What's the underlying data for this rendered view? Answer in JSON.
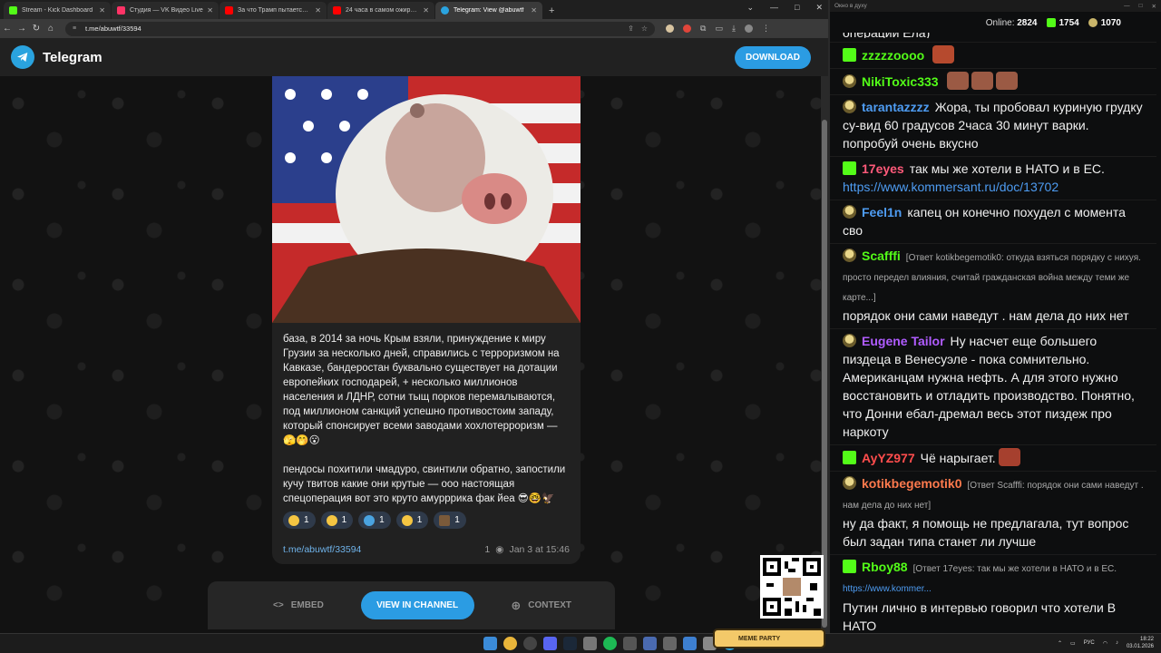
{
  "browser": {
    "tabs": [
      {
        "title": "Stream - Kick Dashboard",
        "color": "#53fc18",
        "active": false
      },
      {
        "title": "Студия — VK Видео Live",
        "color": "#ff3366",
        "active": false
      },
      {
        "title": "За что Трамп пытается убить",
        "color": "#ff0000",
        "active": false
      },
      {
        "title": "24 часа в самом ожиревшем",
        "color": "#ff0000",
        "active": false
      },
      {
        "title": "Telegram: View @abuwtf",
        "color": "#2aa3df",
        "active": true
      }
    ],
    "new_tab": "+",
    "url": "t.me/abuwtf/33594"
  },
  "telegram": {
    "brand": "Telegram",
    "download_label": "DOWNLOAD",
    "message_text": "база, в 2014 за ночь Крым взяли, принуждение к миру Грузии за несколько дней, справились с терроризмом на Кавказе, бандеростан буквально существует на дотации европейких господарей, + несколько миллионов населения и ЛДНР, сотни тыщ порков перемалываются, под миллионом санкций успешно противостоим западу, который спонсирует всеми заводами хохлотерроризм — 🫣🤭😮\n\nпендосы похитили чмадуро, свинтили обратно, запостили кучу твитов какие они крутые — ооо настоящая спецоперация вот это круто амурррика фак йеа 😎🤓🦅",
    "reactions": [
      {
        "emoji": "👍",
        "count": "1",
        "color": "#f4c542"
      },
      {
        "emoji": "😁",
        "count": "1",
        "color": "#f4c542"
      },
      {
        "emoji": "🐳",
        "count": "1",
        "color": "#4aa3e0"
      },
      {
        "emoji": "😂",
        "count": "1",
        "color": "#f4c542"
      },
      {
        "emoji": "sticker",
        "count": "1",
        "color": "#7a5a3a"
      }
    ],
    "post_link": "t.me/abuwtf/33594",
    "views": "1",
    "date": "Jan 3 at 15:46",
    "embed_label": "EMBED",
    "view_channel_label": "VIEW IN CHANNEL",
    "context_label": "CONTEXT"
  },
  "chat": {
    "window_title": "Окно в духу",
    "online_label": "Online:",
    "online_count": "2824",
    "stat_kick": "1754",
    "stat_other": "1070",
    "top_fragment": "операции Ела)",
    "messages": [
      {
        "badge": "kick",
        "user": "zzzzzoooo",
        "color": "#53fc18",
        "reply": "",
        "text": "",
        "link": ""
      },
      {
        "badge": "hat",
        "user": "NikiToxic333",
        "color": "#53fc18",
        "reply": "",
        "text": "",
        "link": ""
      },
      {
        "badge": "hat",
        "user": "tarantazzzz",
        "color": "#4e9cf2",
        "reply": "",
        "text": "Жора, ты пробовал куриную грудку су-вид 60 градусов 2часа 30 минут варки. попробуй очень вкусно",
        "link": ""
      },
      {
        "badge": "kick",
        "user": "17eyes",
        "color": "#ff5a7a",
        "reply": "",
        "text": "так мы же хотели в НАТО и в ЕС.",
        "link": "https://www.kommersant.ru/doc/13702"
      },
      {
        "badge": "hat",
        "user": "Feel1n",
        "color": "#4e9cf2",
        "reply": "",
        "text": "капец он конечно похудел с момента сво",
        "link": ""
      },
      {
        "badge": "hat",
        "user": "Scafffi",
        "color": "#53fc18",
        "reply": "[Ответ kotikbegemotik0: откуда взяться порядку с нихуя. просто передел влияния, считай гражданская война между теми же карте...]",
        "text": "порядок они сами наведут . нам дела до них нет",
        "link": ""
      },
      {
        "badge": "hat",
        "user": "Eugene Tailor",
        "color": "#b05cff",
        "reply": "",
        "text": "Ну насчет еще большего пиздеца в Венесуэле - пока сомнительно. Американцам нужна нефть. А для этого нужно восстановить и отладить производство. Понятно, что Донни ебал-дремал весь этот пиздеж про наркоту",
        "link": ""
      },
      {
        "badge": "kick",
        "user": "AyYZ977",
        "color": "#ff4d4d",
        "reply": "",
        "text": "Чё нарыгает.",
        "link": ""
      },
      {
        "badge": "hat",
        "user": "kotikbegemotik0",
        "color": "#ff7a4d",
        "reply": "[Ответ Scafffi: порядок они сами наведут . нам дела до них нет]",
        "text": "ну да факт, я помощь не предлагала, тут вопрос был задан типа станет ли лучше",
        "link": ""
      },
      {
        "badge": "kick",
        "user": "Rboy88",
        "color": "#53fc18",
        "reply": "[Ответ 17eyes: так мы же хотели в НАТО и в ЕС.",
        "text": "Путин лично в интервью говорил что хотели В НАТО",
        "link": "https://www.kommer..."
      }
    ]
  },
  "overlay": {
    "meme_label": "MEME PARTY"
  },
  "taskbar": {
    "lang": "РУС",
    "time": "18:22",
    "date": "03.01.2026"
  }
}
